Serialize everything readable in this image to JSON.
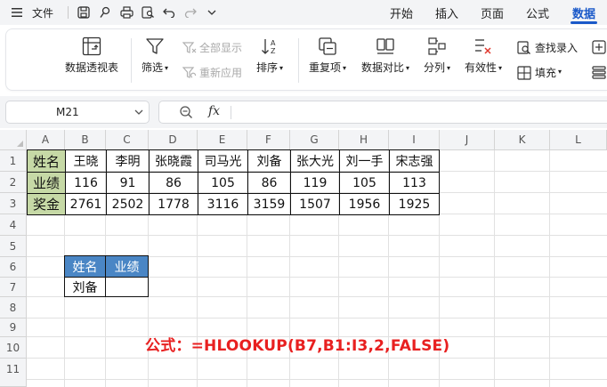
{
  "menu": {
    "file_label": "文件",
    "tabs": [
      "开始",
      "插入",
      "页面",
      "公式",
      "数据"
    ],
    "active_tab": "数据"
  },
  "ribbon": {
    "pivot": "数据透视表",
    "filter": "筛选",
    "show_all": "全部显示",
    "reapply": "重新应用",
    "sort": "排序",
    "duplicates": "重复项",
    "compare": "数据对比",
    "split": "分列",
    "validity": "有效性",
    "find_entry": "查找录入",
    "fill": "填充"
  },
  "formula_bar": {
    "name_box": "M21",
    "fx_label": "fx",
    "content": ""
  },
  "columns": [
    "A",
    "B",
    "C",
    "D",
    "E",
    "F",
    "G",
    "H",
    "I",
    "J",
    "K",
    "L"
  ],
  "rows": [
    "1",
    "2",
    "3",
    "4",
    "5",
    "6",
    "7",
    "8",
    "9",
    "10",
    "11"
  ],
  "table": {
    "headers": [
      "姓名",
      "业绩",
      "奖金"
    ],
    "names": [
      "王晓",
      "李明",
      "张晓霞",
      "司马光",
      "刘备",
      "张大光",
      "刘一手",
      "宋志强"
    ],
    "performance": [
      "116",
      "91",
      "86",
      "105",
      "86",
      "119",
      "105",
      "113"
    ],
    "bonus": [
      "2761",
      "2502",
      "1778",
      "3116",
      "3159",
      "1507",
      "1956",
      "1925"
    ]
  },
  "lookup": {
    "header_name": "姓名",
    "header_perf": "业绩",
    "name_value": "刘备",
    "perf_value": ""
  },
  "note": "公式：=HLOOKUP(B7,B1:I3,2,FALSE)",
  "colors": {
    "accent": "#1a59c9",
    "header_green": "#c6d9a6",
    "header_blue": "#4a86c5",
    "formula_red": "#e82020"
  }
}
